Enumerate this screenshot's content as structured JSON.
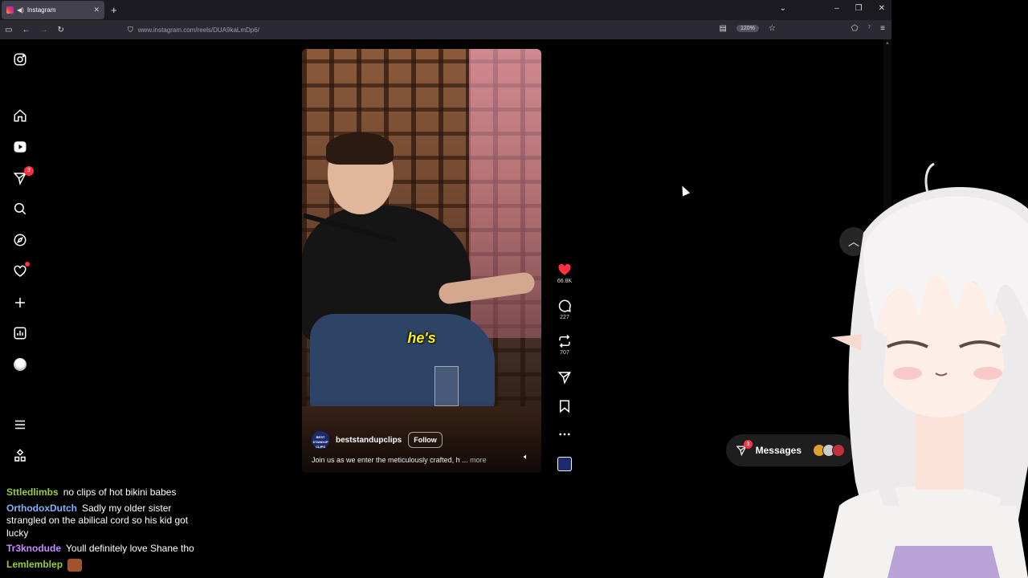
{
  "browser": {
    "tab_title": "Instagram",
    "url": "www.instagram.com/reels/DUA9kaLmDp6/",
    "zoom": "120%"
  },
  "sidebar": {
    "notifications_badge": "3"
  },
  "reel": {
    "caption_word": "he's",
    "account_name": "beststandupclips",
    "account_avatar_text": "BEST STANDUP CLIPS",
    "follow_label": "Follow",
    "description": "Join us as we enter the meticulously crafted, h ...",
    "more_label": "more"
  },
  "actions": {
    "likes": "66.8K",
    "comments": "227",
    "reposts": "707"
  },
  "messages": {
    "label": "Messages",
    "badge": "3"
  },
  "chat": [
    {
      "user": "Sttledlimbs",
      "color": "#9acd32",
      "message": "no clips of hot bikini babes"
    },
    {
      "user": "OrthodoxDutch",
      "color": "#7fb3ff",
      "message": "Sadly my older sister strangled on the abilical cord so his kid got lucky"
    },
    {
      "user": "Tr3knodude",
      "color": "#c78cff",
      "message": "Youll definitely love Shane tho"
    },
    {
      "user": "Lemlemblep",
      "color": "#9acd32",
      "message": ""
    }
  ],
  "colors": {
    "instagram_like": "#ff3040",
    "caption_yellow": "#fff200"
  }
}
